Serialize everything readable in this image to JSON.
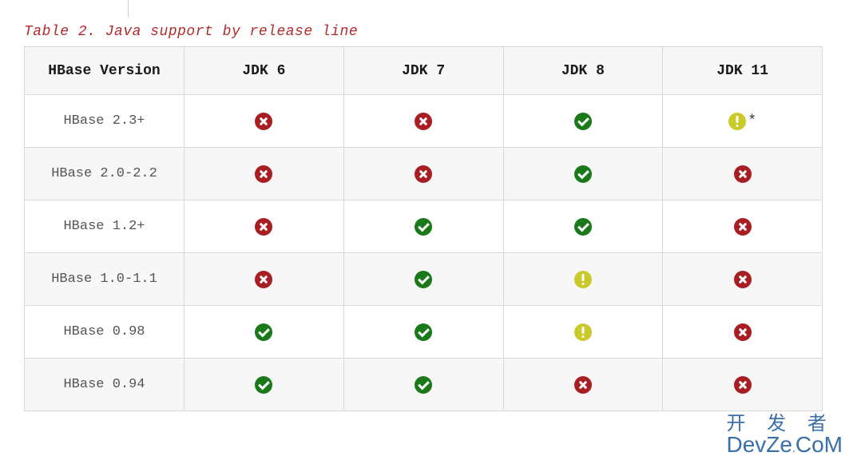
{
  "caption": "Table 2. Java support by release line",
  "headers": [
    "HBase Version",
    "JDK 6",
    "JDK 7",
    "JDK 8",
    "JDK 11"
  ],
  "rows": [
    {
      "version": "HBase 2.3+",
      "cells": [
        {
          "icon": "cross"
        },
        {
          "icon": "cross"
        },
        {
          "icon": "check"
        },
        {
          "icon": "warn",
          "suffix": "*"
        }
      ]
    },
    {
      "version": "HBase 2.0-2.2",
      "cells": [
        {
          "icon": "cross"
        },
        {
          "icon": "cross"
        },
        {
          "icon": "check"
        },
        {
          "icon": "cross"
        }
      ]
    },
    {
      "version": "HBase 1.2+",
      "cells": [
        {
          "icon": "cross"
        },
        {
          "icon": "check"
        },
        {
          "icon": "check"
        },
        {
          "icon": "cross"
        }
      ]
    },
    {
      "version": "HBase 1.0-1.1",
      "cells": [
        {
          "icon": "cross"
        },
        {
          "icon": "check"
        },
        {
          "icon": "warn"
        },
        {
          "icon": "cross"
        }
      ]
    },
    {
      "version": "HBase 0.98",
      "cells": [
        {
          "icon": "check"
        },
        {
          "icon": "check"
        },
        {
          "icon": "warn"
        },
        {
          "icon": "cross"
        }
      ]
    },
    {
      "version": "HBase 0.94",
      "cells": [
        {
          "icon": "check"
        },
        {
          "icon": "check"
        },
        {
          "icon": "cross"
        },
        {
          "icon": "cross"
        }
      ]
    }
  ],
  "watermark": {
    "top": "开 发 者",
    "bottomBig": "DevZe",
    "bottomDot": ".",
    "bottomCom": "CoM"
  },
  "chart_data": {
    "type": "table",
    "title": "Table 2. Java support by release line",
    "columns": [
      "HBase Version",
      "JDK 6",
      "JDK 7",
      "JDK 8",
      "JDK 11"
    ],
    "legend": {
      "check": "supported",
      "cross": "not supported",
      "warn": "warning/partial"
    },
    "rows": [
      {
        "HBase Version": "HBase 2.3+",
        "JDK 6": "cross",
        "JDK 7": "cross",
        "JDK 8": "check",
        "JDK 11": "warn*"
      },
      {
        "HBase Version": "HBase 2.0-2.2",
        "JDK 6": "cross",
        "JDK 7": "cross",
        "JDK 8": "check",
        "JDK 11": "cross"
      },
      {
        "HBase Version": "HBase 1.2+",
        "JDK 6": "cross",
        "JDK 7": "check",
        "JDK 8": "check",
        "JDK 11": "cross"
      },
      {
        "HBase Version": "HBase 1.0-1.1",
        "JDK 6": "cross",
        "JDK 7": "check",
        "JDK 8": "warn",
        "JDK 11": "cross"
      },
      {
        "HBase Version": "HBase 0.98",
        "JDK 6": "check",
        "JDK 7": "check",
        "JDK 8": "warn",
        "JDK 11": "cross"
      },
      {
        "HBase Version": "HBase 0.94",
        "JDK 6": "check",
        "JDK 7": "check",
        "JDK 8": "cross",
        "JDK 11": "cross"
      }
    ]
  }
}
